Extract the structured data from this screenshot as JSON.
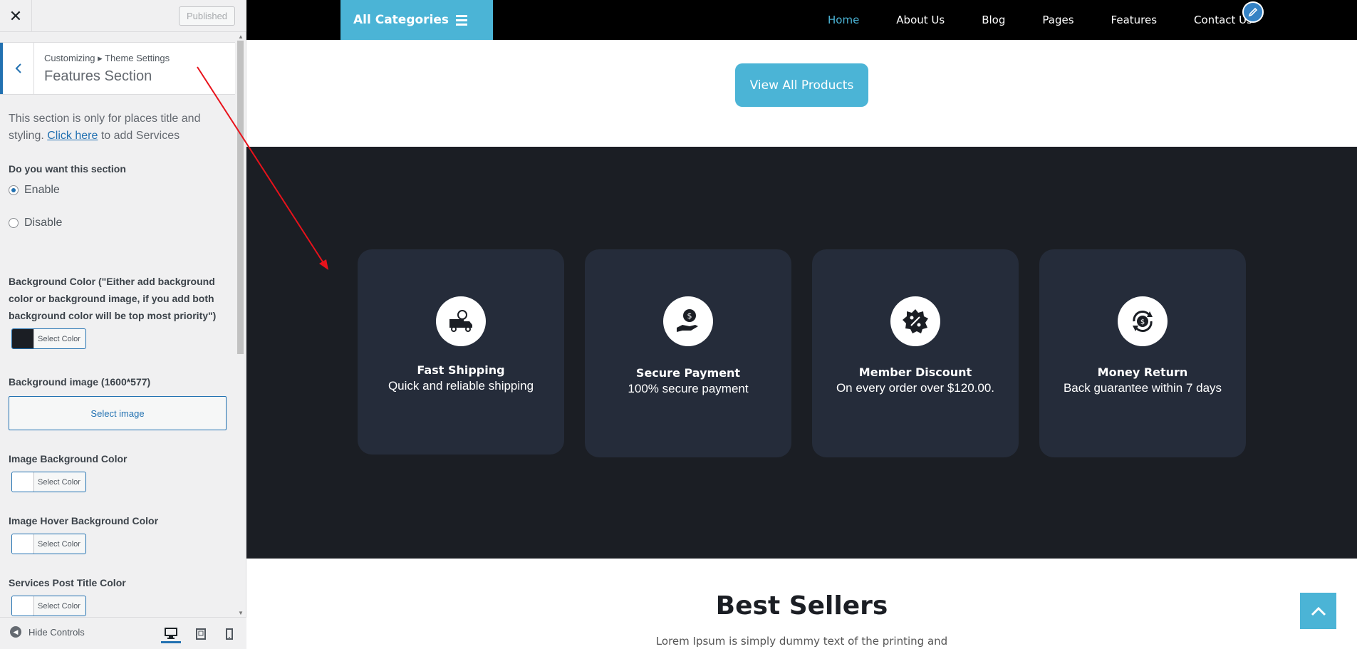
{
  "sidebar": {
    "close_label": "✕",
    "published_label": "Published",
    "breadcrumb": "Customizing ▸ Theme Settings",
    "section_title": "Features Section",
    "description_prefix": "This section is only for places title and styling. ",
    "description_link": "Click here",
    "description_suffix": " to add Services",
    "want_section_label": "Do you want this section",
    "radio_enable": "Enable",
    "radio_disable": "Disable",
    "radio_selected": "Enable",
    "bg_color_label": "Background Color (\"Either add background color or background image, if you add both background color will be top most priority\")",
    "bg_color_value": "#1b1e24",
    "select_color_label": "Select Color",
    "bg_image_label": "Background image (1600*577)",
    "select_image_label": "Select image",
    "image_bg_color_label": "Image Background Color",
    "image_hover_bg_color_label": "Image Hover Background Color",
    "services_post_title_color_label": "Services Post Title Color",
    "hide_controls_label": "Hide Controls"
  },
  "preview": {
    "all_categories_label": "All Categories",
    "nav": [
      "Home",
      "About Us",
      "Blog",
      "Pages",
      "Features",
      "Contact Us"
    ],
    "nav_active": "Home",
    "view_all_label": "View All Products",
    "features": [
      {
        "title": "Fast Shipping",
        "subtitle": "Quick and reliable shipping",
        "icon": "delivery-truck-icon"
      },
      {
        "title": "Secure Payment",
        "subtitle": "100% secure payment",
        "icon": "dollar-hand-icon"
      },
      {
        "title": "Member Discount",
        "subtitle": "On every order over $120.00.",
        "icon": "percent-badge-icon"
      },
      {
        "title": "Money Return",
        "subtitle": "Back guarantee within 7 days",
        "icon": "money-return-icon"
      }
    ],
    "best_sellers_title": "Best Sellers",
    "best_sellers_subtitle": "Lorem Ipsum is simply dummy text of the printing and"
  },
  "colors": {
    "accent": "#4bb4d6",
    "dark_section": "#1b1e24",
    "card": "#252c3a",
    "wp_blue": "#2271b1",
    "annotation_arrow": "#e8121b"
  }
}
